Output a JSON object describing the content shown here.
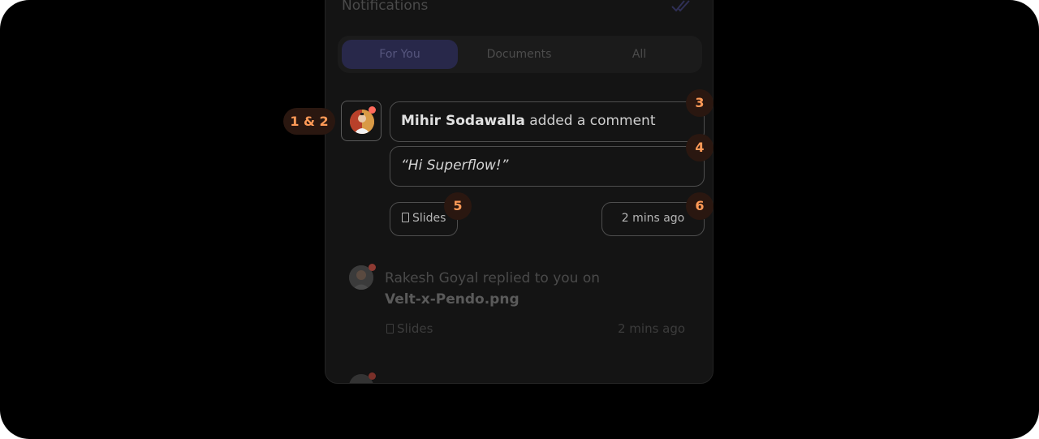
{
  "notifications": {
    "title": "Notifications",
    "tabs": [
      {
        "label": "For You",
        "active": true
      },
      {
        "label": "Documents",
        "active": false
      },
      {
        "label": "All",
        "active": false
      }
    ],
    "items": [
      {
        "author": "Mihir Sodawalla",
        "action": " added a comment",
        "quote": "“Hi Superflow!”",
        "doc_type": "Slides",
        "time": "2 mins ago"
      },
      {
        "author": "Rakesh Goyal",
        "action": " replied to you on",
        "file": "Velt-x-Pendo.png",
        "doc_type": "Slides",
        "time": "2 mins ago"
      }
    ]
  },
  "badges": {
    "b12": "1 & 2",
    "b3": "3",
    "b4": "4",
    "b5": "5",
    "b6": "6"
  },
  "colors": {
    "accent_badge": "#ff9a57",
    "unread_dot": "#ff6a5c",
    "active_tab": "#28284a"
  }
}
